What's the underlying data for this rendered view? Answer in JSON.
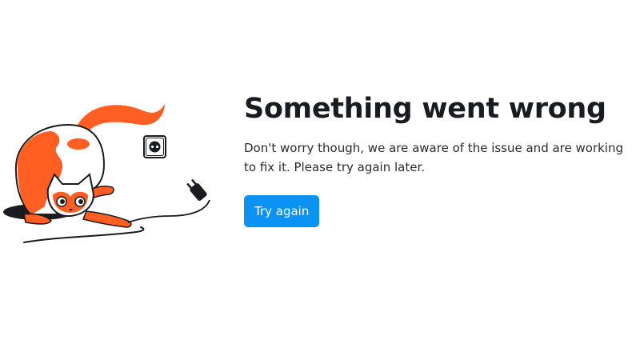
{
  "error": {
    "title": "Something went wrong",
    "message": "Don't worry though, we are aware of the issue and are working to fix it. Please try again later.",
    "retry_label": "Try again"
  },
  "illustration": {
    "icon": "unplugged-cat-illustration",
    "colors": {
      "accent": "#ff5f23",
      "outline": "#1a1b20",
      "button": "#0a93f5"
    }
  }
}
